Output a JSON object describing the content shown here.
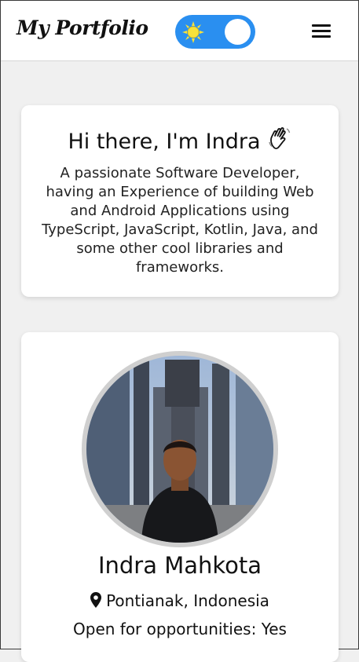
{
  "header": {
    "logo_text": "My Portfolio",
    "theme_toggle_state": "light",
    "accent_color": "#2a8ff0",
    "menu_icon": "hamburger-menu-icon"
  },
  "intro": {
    "greeting": "Hi there, I'm Indra",
    "greeting_icon": "waving-hand-icon",
    "description": "A passionate Software Developer, having an Experience of building Web and Android Applications using TypeScript, JavaScript, Kotlin, Java, and some other cool libraries and frameworks."
  },
  "profile": {
    "name": "Indra Mahkota",
    "location_icon": "location-pin-icon",
    "location": "Pontianak, Indonesia",
    "status": "Open for opportunities: Yes"
  }
}
